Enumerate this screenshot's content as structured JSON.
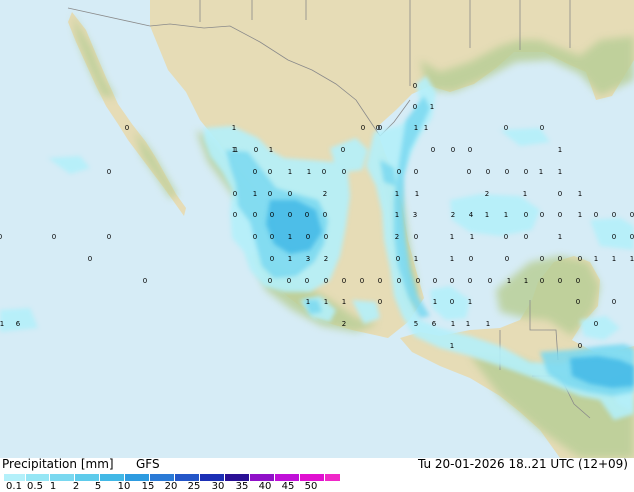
{
  "footer": {
    "title": "Precipitation [mm]",
    "model": "GFS",
    "datetime": "Tu 20-01-2026 18..21 UTC (12+09)"
  },
  "scale": {
    "ticks": [
      "0.1",
      "0.5",
      "1",
      "2",
      "5",
      "10",
      "15",
      "20",
      "25",
      "30",
      "35",
      "40",
      "45",
      "50"
    ],
    "colors": [
      "#b4f0fa",
      "#96e6f5",
      "#7ad8f0",
      "#5ecbeb",
      "#42b8e6",
      "#2d9be0",
      "#2a7ad6",
      "#2456c8",
      "#1b2fb5",
      "#2a1095",
      "#9010c8",
      "#c010d8",
      "#e010d0",
      "#f028c8"
    ]
  },
  "map": {
    "colors": {
      "ocean": "#d6ecf6",
      "land": "#e6dcb6",
      "land_green": "#b9cf97",
      "precip_light": "#b4f0fa",
      "precip_mid": "#7ad8f0",
      "precip_heavy": "#42b8e6"
    },
    "labels": [
      {
        "t": "0"
      },
      {
        "t": "0"
      },
      {
        "t": "1"
      },
      {
        "t": "0"
      },
      {
        "t": "0"
      },
      {
        "t": "0"
      },
      {
        "t": "0"
      },
      {
        "t": "1"
      },
      {
        "t": "1"
      },
      {
        "t": "1"
      },
      {
        "t": "0"
      },
      {
        "t": "0"
      },
      {
        "t": "1"
      },
      {
        "t": "1"
      },
      {
        "t": "0"
      },
      {
        "t": "1"
      },
      {
        "t": "0"
      },
      {
        "t": "0"
      },
      {
        "t": "0"
      },
      {
        "t": "0"
      },
      {
        "t": "1"
      },
      {
        "t": "0"
      },
      {
        "t": "0"
      },
      {
        "t": "0"
      },
      {
        "t": "1"
      },
      {
        "t": "1"
      },
      {
        "t": "0"
      },
      {
        "t": "0"
      },
      {
        "t": "0"
      },
      {
        "t": "0"
      },
      {
        "t": "0"
      },
      {
        "t": "0"
      },
      {
        "t": "0"
      },
      {
        "t": "0"
      },
      {
        "t": "1"
      },
      {
        "t": "1"
      },
      {
        "t": "0"
      },
      {
        "t": "1"
      },
      {
        "t": "0"
      },
      {
        "t": "0"
      },
      {
        "t": "2"
      },
      {
        "t": "1"
      },
      {
        "t": "1"
      },
      {
        "t": "2"
      },
      {
        "t": "1"
      },
      {
        "t": "0"
      },
      {
        "t": "1"
      },
      {
        "t": "0"
      },
      {
        "t": "0"
      },
      {
        "t": "0"
      },
      {
        "t": "0"
      },
      {
        "t": "0"
      },
      {
        "t": "0"
      },
      {
        "t": "1"
      },
      {
        "t": "3"
      },
      {
        "t": "2"
      },
      {
        "t": "4"
      },
      {
        "t": "1"
      },
      {
        "t": "1"
      },
      {
        "t": "0"
      },
      {
        "t": "0"
      },
      {
        "t": "0"
      },
      {
        "t": "1"
      },
      {
        "t": "0"
      },
      {
        "t": "0"
      },
      {
        "t": "0"
      },
      {
        "t": "0"
      },
      {
        "t": "0"
      },
      {
        "t": "0"
      },
      {
        "t": "0"
      },
      {
        "t": "0"
      },
      {
        "t": "1"
      },
      {
        "t": "0"
      },
      {
        "t": "0"
      },
      {
        "t": "2"
      },
      {
        "t": "0"
      },
      {
        "t": "1"
      },
      {
        "t": "1"
      },
      {
        "t": "0"
      },
      {
        "t": "0"
      },
      {
        "t": "1"
      },
      {
        "t": "0"
      },
      {
        "t": "0"
      },
      {
        "t": "0"
      },
      {
        "t": "0"
      },
      {
        "t": "1"
      },
      {
        "t": "3"
      },
      {
        "t": "2"
      },
      {
        "t": "0"
      },
      {
        "t": "1"
      },
      {
        "t": "1"
      },
      {
        "t": "0"
      },
      {
        "t": "0"
      },
      {
        "t": "0"
      },
      {
        "t": "0"
      },
      {
        "t": "0"
      },
      {
        "t": "1"
      },
      {
        "t": "1"
      },
      {
        "t": "1"
      },
      {
        "t": "0"
      },
      {
        "t": "0"
      },
      {
        "t": "0"
      },
      {
        "t": "0"
      },
      {
        "t": "0"
      },
      {
        "t": "0"
      },
      {
        "t": "0"
      },
      {
        "t": "0"
      },
      {
        "t": "0"
      },
      {
        "t": "0"
      },
      {
        "t": "0"
      },
      {
        "t": "0"
      },
      {
        "t": "0"
      },
      {
        "t": "0"
      },
      {
        "t": "1"
      },
      {
        "t": "1"
      },
      {
        "t": "0"
      },
      {
        "t": "0"
      },
      {
        "t": "0"
      },
      {
        "t": "1"
      },
      {
        "t": "1"
      },
      {
        "t": "1"
      },
      {
        "t": "0"
      },
      {
        "t": "1"
      },
      {
        "t": "0"
      },
      {
        "t": "1"
      },
      {
        "t": "0"
      },
      {
        "t": "0"
      },
      {
        "t": "1"
      },
      {
        "t": "6"
      },
      {
        "t": "2"
      },
      {
        "t": "5"
      },
      {
        "t": "6"
      },
      {
        "t": "1"
      },
      {
        "t": "1"
      },
      {
        "t": "1"
      },
      {
        "t": "0"
      },
      {
        "t": "1"
      },
      {
        "t": "0"
      }
    ]
  }
}
